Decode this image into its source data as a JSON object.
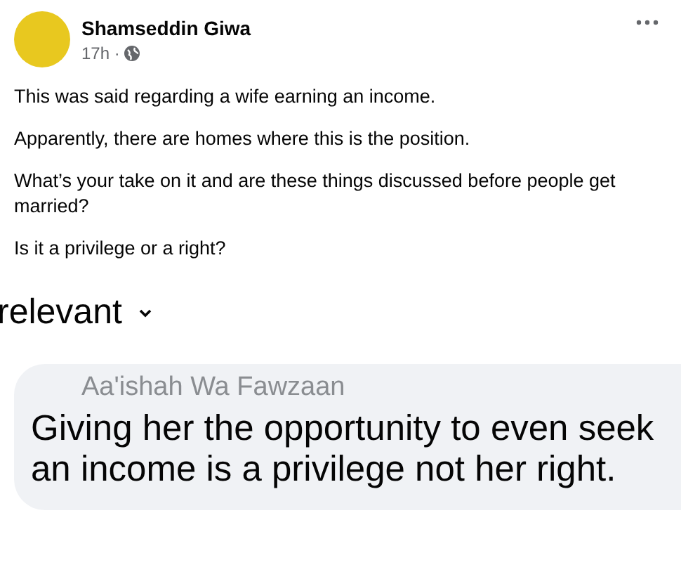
{
  "post": {
    "author": "Shamseddin Giwa",
    "time": "17h ·",
    "paragraphs": [
      "This was said regarding a wife earning an income.",
      "Apparently, there are homes where this is the position.",
      "What’s your take on it and are these things discussed before people get married?",
      "Is it a privilege or a right?"
    ]
  },
  "comments": {
    "sort_label": "relevant",
    "items": [
      {
        "author": "Aa'ishah Wa Fawzaan",
        "text": "Giving her the opportunity to even seek an income is a privilege not her right."
      }
    ]
  }
}
